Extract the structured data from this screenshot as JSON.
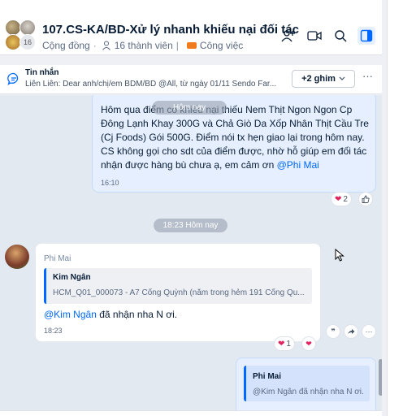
{
  "header": {
    "title": "107.CS-KA/BD-Xử lý nhanh khiếu nại đối tác",
    "community_label": "Cộng đồng",
    "members_label": "16 thành viên",
    "tag_label": "Công việc",
    "avatar_count": "16",
    "icons": [
      "add-group-icon",
      "video-call-icon",
      "search-icon",
      "panel-toggle-icon"
    ]
  },
  "pinned": {
    "title": "Tin nhắn",
    "text": "Liên Liên: Dear anh/chị/em BDM/BD @All, từ ngày 01/11 Sendo Far...",
    "pin_button": "+2 ghim",
    "more": "···"
  },
  "messages": {
    "sep_top": "Hôm nay",
    "msg1": {
      "text_before": "Hôm qua điểm có khiếu nại thiếu Nem Thịt Ngon Ngon Cp Đông Lạnh Khay 300G và Chả Giò Da Xốp Nhân Thịt Cầu Tre (Cj Foods) Gói 500G. Điểm nói tx hẹn giao lại trong hôm nay. CS không gọi cho sdt của điểm được, nhờ hỗ giúp em đối tác nhận được hàng bù chưa ạ, em cảm ơn ",
      "mention": "@Phi Mai",
      "time": "16:10",
      "react_count": "2"
    },
    "sep_mid": "18:23 Hôm nay",
    "msg2": {
      "sender": "Phi Mai",
      "quote_name": "Kim Ngân",
      "quote_text": "HCM_Q01_000073 - A7 Cống Quỳnh (nằm trong hẻm 191 Cống Qu...",
      "mention": "@Kim Ngân",
      "text_after": " đã nhận nha N ơi.",
      "time": "18:23",
      "react_count": "1"
    },
    "msg3": {
      "quote_name": "Phi Mai",
      "quote_text": "@Kim Ngân đã nhận nha N ơi."
    }
  },
  "colors": {
    "accent": "#0068ff",
    "bubble_me": "#e5efff",
    "chat_bg": "#e2e9f1",
    "tag": "#f07b1d"
  }
}
